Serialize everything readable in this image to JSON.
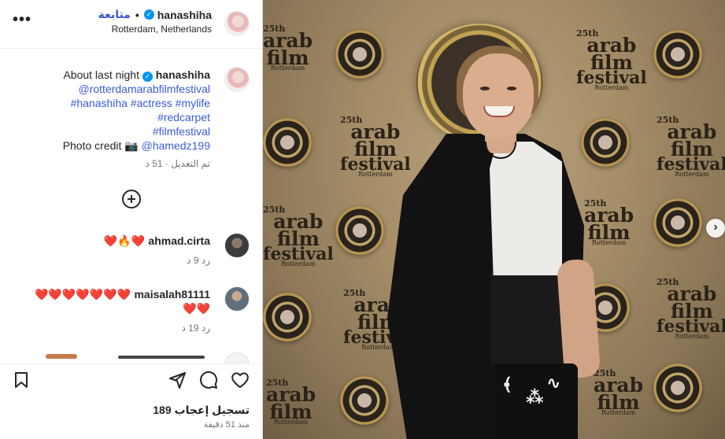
{
  "header": {
    "more_glyph": "•••",
    "follow_label": "متابعة",
    "separator": "•",
    "username": "hanashiha",
    "verified_glyph": "✓",
    "location": "Rotterdam, Netherlands"
  },
  "caption": {
    "username": "hanashiha",
    "text": "About last night",
    "lines": [
      "@rotterdamarabfilmfestival",
      "#hanashiha #actress #mylife",
      "#redcarpet",
      "#filmfestival"
    ],
    "credit_prefix": "Photo credit 📷",
    "credit_handle": "@hamedz199",
    "edited": "تم التعديل · 51 د"
  },
  "add_comment_glyph": "+",
  "comments": [
    {
      "username": "ahmad.cirta",
      "text": "❤️🔥❤️",
      "time": "9 د",
      "reply": "رد"
    },
    {
      "username": "maisalah81111",
      "text": "❤️❤️❤️❤️❤️❤️❤️",
      "text2": "❤️❤️",
      "time": "19 د",
      "reply": "رد"
    }
  ],
  "actions": {
    "likes": "189 تسجيل إعجاب",
    "time_ago": "منذ 51 دقيقة"
  },
  "photo": {
    "brand_year": "25th",
    "brand_word1": "arab",
    "brand_word2": "film",
    "brand_word3": "festival",
    "brand_city": "Rotterdam",
    "next_glyph": "›"
  },
  "colors": {
    "accent": "#3b5bdb",
    "heart": "#e0203b",
    "verified": "#0095f6",
    "backdrop": "#a58d68"
  }
}
